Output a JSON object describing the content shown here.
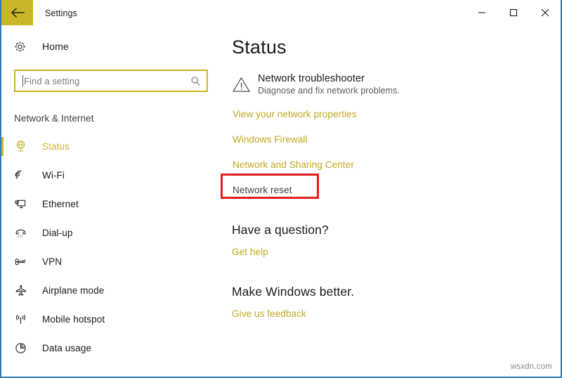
{
  "window": {
    "title": "Settings",
    "back_icon": "back-arrow-icon",
    "accent_color": "#c9b727",
    "border_color": "#2b7cb8",
    "controls": {
      "minimize": "minimize-icon",
      "maximize": "maximize-icon",
      "close": "close-icon"
    }
  },
  "sidebar": {
    "home": {
      "label": "Home",
      "icon": "gear-icon"
    },
    "search": {
      "placeholder": "Find a setting",
      "value": "",
      "icon": "search-icon"
    },
    "section_header": "Network & Internet",
    "items": [
      {
        "label": "Status",
        "icon": "globe-icon",
        "selected": true
      },
      {
        "label": "Wi-Fi",
        "icon": "wifi-icon",
        "selected": false
      },
      {
        "label": "Ethernet",
        "icon": "ethernet-icon",
        "selected": false
      },
      {
        "label": "Dial-up",
        "icon": "phone-icon",
        "selected": false
      },
      {
        "label": "VPN",
        "icon": "vpn-key-icon",
        "selected": false
      },
      {
        "label": "Airplane mode",
        "icon": "airplane-icon",
        "selected": false
      },
      {
        "label": "Mobile hotspot",
        "icon": "hotspot-icon",
        "selected": false
      },
      {
        "label": "Data usage",
        "icon": "pie-chart-icon",
        "selected": false
      }
    ]
  },
  "main": {
    "page_title": "Status",
    "troubleshooter": {
      "icon": "warning-triangle-icon",
      "title": "Network troubleshooter",
      "subtitle": "Diagnose and fix network problems."
    },
    "links": [
      {
        "label": "View your network properties",
        "style": "link"
      },
      {
        "label": "Windows Firewall",
        "style": "link"
      },
      {
        "label": "Network and Sharing Center",
        "style": "link"
      },
      {
        "label": "Network reset",
        "style": "plain",
        "highlighted": true
      }
    ],
    "question_section": {
      "title": "Have a question?",
      "link": "Get help"
    },
    "feedback_section": {
      "title": "Make Windows better.",
      "link": "Give us feedback"
    },
    "annotation": {
      "color": "#e11d1d",
      "target": "Network reset"
    }
  },
  "watermark": "wsxdn.com"
}
